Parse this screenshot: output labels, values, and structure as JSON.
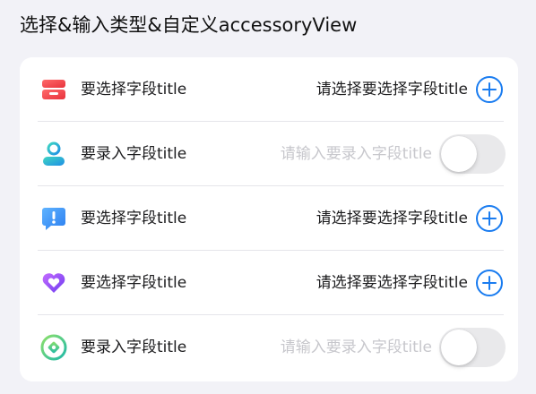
{
  "section": {
    "title": "选择&输入类型&自定义accessoryView"
  },
  "rows": [
    {
      "kind": "select",
      "icon": "inbox-icon",
      "label": "要选择字段title",
      "value": "请选择要选择字段title",
      "accessory": "plus-circle-icon"
    },
    {
      "kind": "input",
      "icon": "user-icon",
      "label": "要录入字段title",
      "placeholder": "请输入要录入字段title",
      "accessory": "toggle-switch",
      "toggle_on": false
    },
    {
      "kind": "select",
      "icon": "message-alert-icon",
      "label": "要选择字段title",
      "value": "请选择要选择字段title",
      "accessory": "plus-circle-icon"
    },
    {
      "kind": "select",
      "icon": "heart-icon",
      "label": "要选择字段title",
      "value": "请选择要选择字段title",
      "accessory": "plus-circle-icon"
    },
    {
      "kind": "input",
      "icon": "target-icon",
      "label": "要录入字段title",
      "placeholder": "请输入要录入字段title",
      "accessory": "toggle-switch",
      "toggle_on": false
    }
  ],
  "colors": {
    "background": "#f2f2f7",
    "card": "#ffffff",
    "accent_blue": "#1a7cf0",
    "placeholder": "#c7c7cc",
    "toggle_off": "#e9e9eb"
  }
}
